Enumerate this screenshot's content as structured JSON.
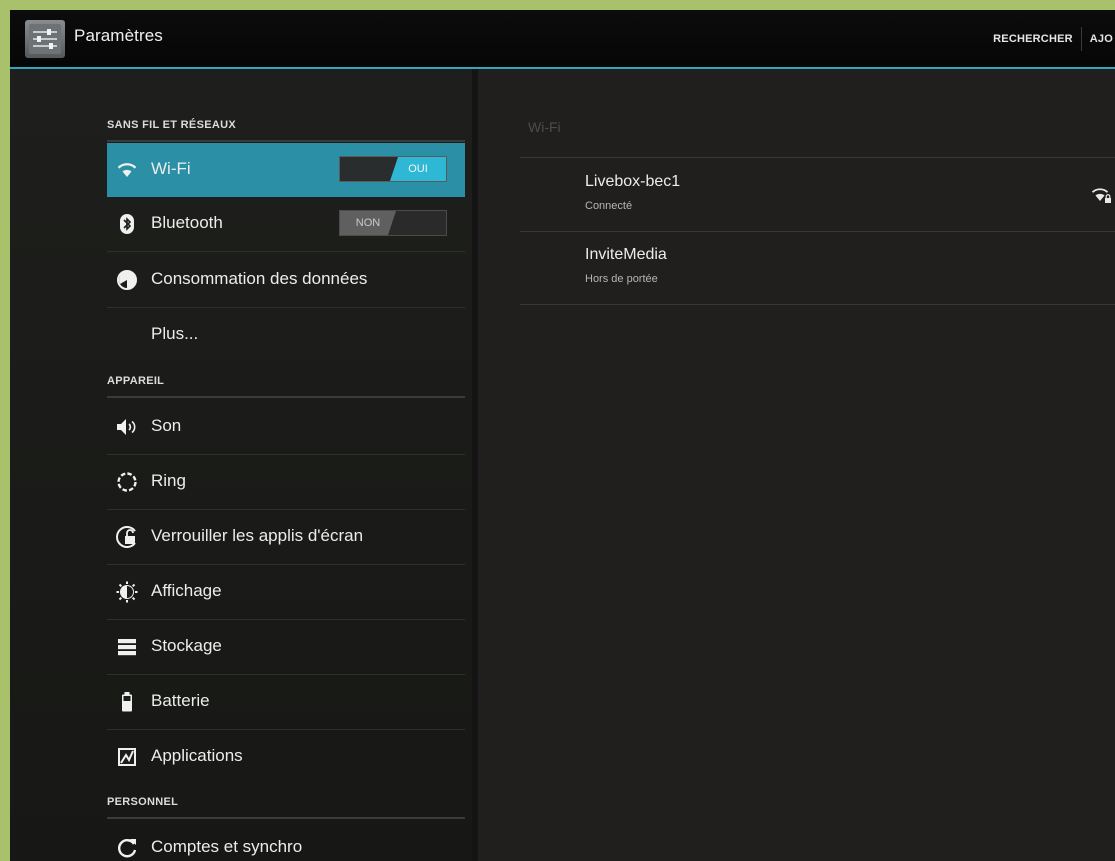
{
  "action_bar": {
    "title": "Paramètres",
    "actions": [
      "RECHERCHER",
      "AJO"
    ],
    "icon": "settings-sliders-icon"
  },
  "sidebar": {
    "sections": [
      {
        "header": "SANS FIL ET RÉSEAUX"
      },
      {
        "header": "APPAREIL"
      },
      {
        "header": "PERSONNEL"
      }
    ],
    "items": [
      {
        "label": "Wi-Fi",
        "icon": "wifi-icon",
        "selected": true,
        "switch": "OUI"
      },
      {
        "label": "Bluetooth",
        "icon": "bluetooth-icon",
        "switch": "NON"
      },
      {
        "label": "Consommation des données",
        "icon": "data-usage-icon"
      },
      {
        "label": "Plus...",
        "icon": ""
      },
      {
        "label": "Son",
        "icon": "volume-icon"
      },
      {
        "label": "Ring",
        "icon": "ring-icon"
      },
      {
        "label": "Verrouiller les applis d'écran",
        "icon": "lock-screen-icon"
      },
      {
        "label": "Affichage",
        "icon": "brightness-icon"
      },
      {
        "label": "Stockage",
        "icon": "storage-icon"
      },
      {
        "label": "Batterie",
        "icon": "battery-icon"
      },
      {
        "label": "Applications",
        "icon": "applications-icon"
      },
      {
        "label": "Comptes et synchro",
        "icon": "sync-icon"
      }
    ]
  },
  "wifi_panel": {
    "title": "Wi-Fi",
    "networks": [
      {
        "ssid": "Livebox-bec1",
        "status": "Connecté",
        "icon": "wifi-signal-locked-icon"
      },
      {
        "ssid": "InviteMedia",
        "status": "Hors de portée"
      }
    ]
  },
  "colors": {
    "accent": "#2fb7d6",
    "selected_row": "#2b8fa6",
    "frame": "#a9c16a"
  }
}
